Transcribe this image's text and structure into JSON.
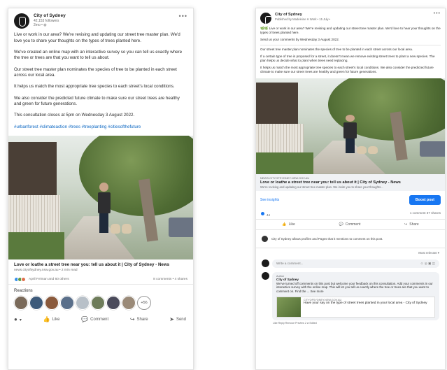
{
  "linkedin": {
    "page_name": "City of Sydney",
    "followers": "42,153 followers",
    "posted": "2mo • ",
    "paragraphs": [
      "Live or work in our area? We're revising and updating our street tree master plan. We'd love you to share your thoughts on the types of trees planted here.",
      "We've created an online map with an interactive survey so you can tell us exactly where the tree or trees are that you want to tell us about.",
      "Our street tree master plan nominates the species of tree to be planted in each street across our local area.",
      "It helps us match the most appropriate tree species to each street's local conditions.",
      "We also consider the predicted future climate to make sure our street trees are healthy and green for future generations.",
      "This consultation closes at 5pm on Wednesday 3 August 2022."
    ],
    "hashtags": "#urbanforest #climateaction #trees #treeplanting #citiesofthefuture",
    "link_title": "Love or loathe a street tree near you: tell us about it | City of Sydney - News",
    "link_sub": "news.cityofsydney.nsw.gov.au • 2 min read",
    "reactors": "April Feiman and 60 others",
    "comments_shares": "8 comments • 4 shares",
    "reactions_title": "Reactions",
    "more_count": "+56",
    "actions": [
      "Like",
      "Comment",
      "Share",
      "Send"
    ]
  },
  "facebook": {
    "page_name": "City of Sydney",
    "published": "Published by Madeleine H Work  •  15 July  •",
    "paragraphs": [
      "Live or work in our area? We're revising and updating our street tree master plan. We'd love to hear your thoughts on the types of trees planted here.",
      "Send us your comments by Wednesday 3 August 2022.",
      "Our street tree master plan nominates the species of tree to be planted in each street across our local area.",
      "If a certain type of tree is proposed for a street, it doesn't mean we remove existing street trees to plant a new species. The plan helps us decide what to plant when trees need replacing.",
      "It helps us match the most appropriate tree species to each street's local conditions. We also consider the predicted future climate to make sure our street trees are healthy and green for future generations."
    ],
    "link_domain": "NEWS.CITYOFSYDNEY.NSW.GOV.AU",
    "link_title": "Love or loathe a street tree near you: tell us about it | City of Sydney - News",
    "link_desc": "We're revising and updating our street tree master plan. We invite you to share your thoughts...",
    "see_insights": "See insights",
    "boost": "Boost post",
    "reaction_count": "44",
    "comments_shares": "1 comment  37 shares",
    "actions": [
      "Like",
      "Comment",
      "Share"
    ],
    "notice": "City of Sydney allows profiles and Pages that it mentions to comment on this post.",
    "most_relevant": "Most relevant ▾",
    "write_placeholder": "Write a comment...",
    "comment": {
      "tag": "Author",
      "author": "City of Sydney",
      "text": "We've turned off comments on this post but welcome your feedback on this consultation. Add your comments in our interactive survey with the online map. This will let you tell us exactly where the tree or trees are that you want to comment on. Find the ... See more",
      "link_domain": "CITYOFSYDNEY.NSW.GOV.AU",
      "link_title": "Have your say on the type of street trees planted in your local area - City of Sydney",
      "meta": "Like   Reply   Remove Preview   2 w   Edited"
    }
  }
}
